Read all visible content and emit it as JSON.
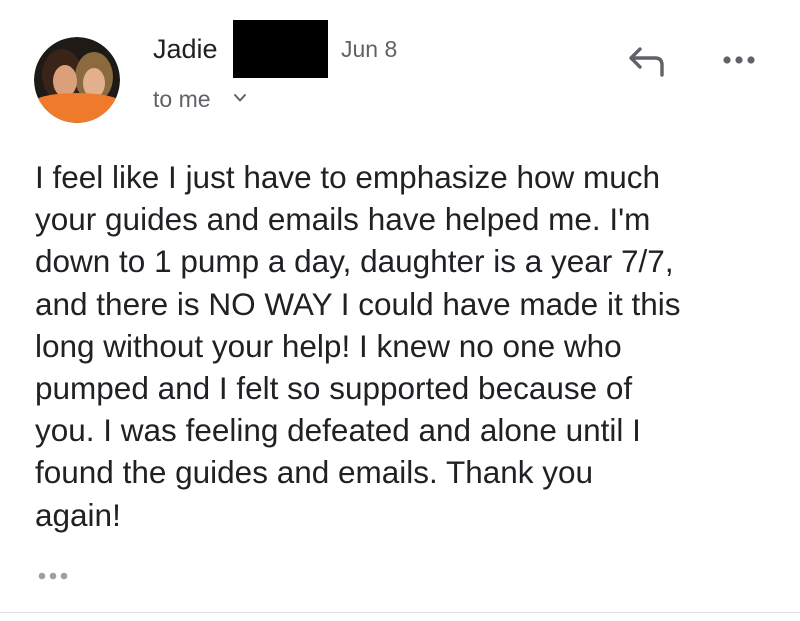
{
  "header": {
    "sender_name": "Jadie",
    "date": "Jun 8",
    "recipient": "to me"
  },
  "icons": {
    "avatar": "sender-photo",
    "redaction": "redaction-box",
    "recipient_toggle": "chevron-down-icon",
    "reply": "reply-icon",
    "more": "more-horizontal-icon",
    "trimmed": "show-trimmed-content-icon"
  },
  "message": {
    "body": "I feel like I just have to emphasize how much\nyour guides and emails have helped me. I'm\ndown to 1 pump a day, daughter is a year 7/7,\nand there is NO WAY I could have made it this\nlong without your help! I knew no one who\npumped and I felt so supported because of\nyou. I was feeling defeated and alone until I\nfound the guides and emails. Thank you\nagain!"
  },
  "colors": {
    "text": "#202124",
    "secondary_text": "#5f6368",
    "icon": "#5f6368",
    "avatar_shirt": "#f07a2c"
  }
}
